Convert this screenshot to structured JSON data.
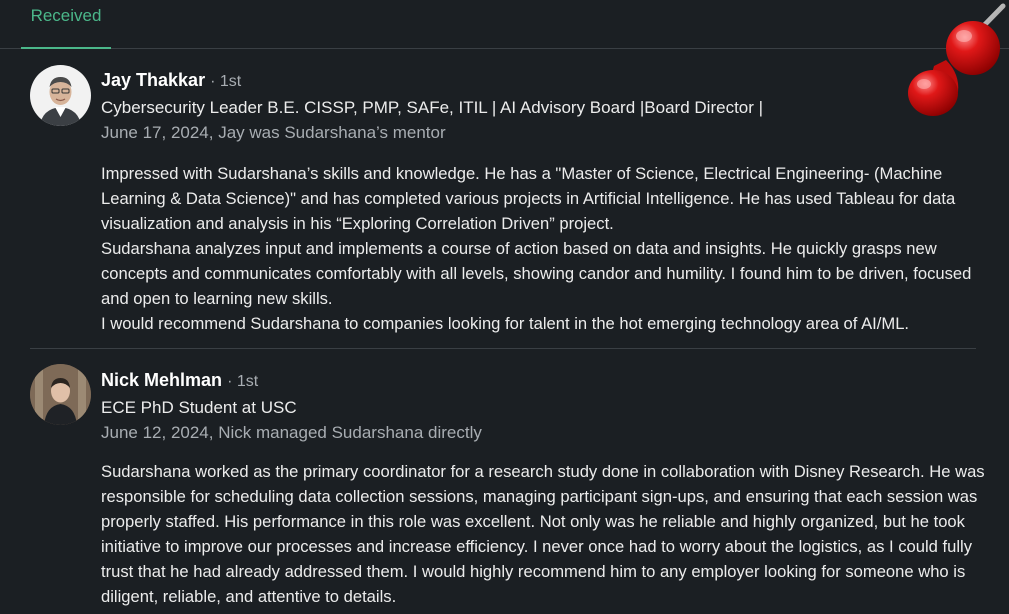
{
  "tabs": {
    "received_label": "Received"
  },
  "recommendations": [
    {
      "name": "Jay Thakkar",
      "degree": "· 1st",
      "headline": "Cybersecurity Leader B.E. CISSP, PMP, SAFe, ITIL | AI Advisory Board |Board Director |",
      "meta": "June 17, 2024, Jay was Sudarshana’s mentor",
      "paragraphs": [
        "Impressed with Sudarshana’s skills and knowledge. He has a \"Master of Science, Electrical Engineering- (Machine Learning & Data Science)\" and has completed various projects in Artificial Intelligence. He has used Tableau for data visualization and analysis in his “Exploring Correlation Driven” project.",
        "Sudarshana analyzes input and implements a course of action based on data and insights. He quickly grasps new concepts and communicates comfortably with all levels, showing candor and humility. I found him to be driven, focused and open to learning new skills.",
        "I would recommend Sudarshana to companies looking for talent in the hot emerging technology area of AI/ML."
      ]
    },
    {
      "name": "Nick Mehlman",
      "degree": "· 1st",
      "headline": "ECE PhD Student at USC",
      "meta": "June 12, 2024, Nick managed Sudarshana directly",
      "paragraphs": [
        "Sudarshana worked as the primary coordinator for a research study done in collaboration with Disney Research. He was responsible for scheduling data collection sessions, managing participant sign-ups, and ensuring that each session was properly staffed. His performance in this role was excellent. Not only was he reliable and highly organized, but he took initiative to improve our processes and increase efficiency. I never once had to worry about the logistics, as I could fully trust that he had already addressed them. I would highly recommend him to any employer looking for someone who is diligent, reliable, and attentive to details."
      ]
    }
  ],
  "icons": {
    "pin": "red-pushpin-icon"
  },
  "colors": {
    "background": "#1b1f23",
    "accent": "#4bb78a",
    "muted_text": "#a8adb2"
  }
}
